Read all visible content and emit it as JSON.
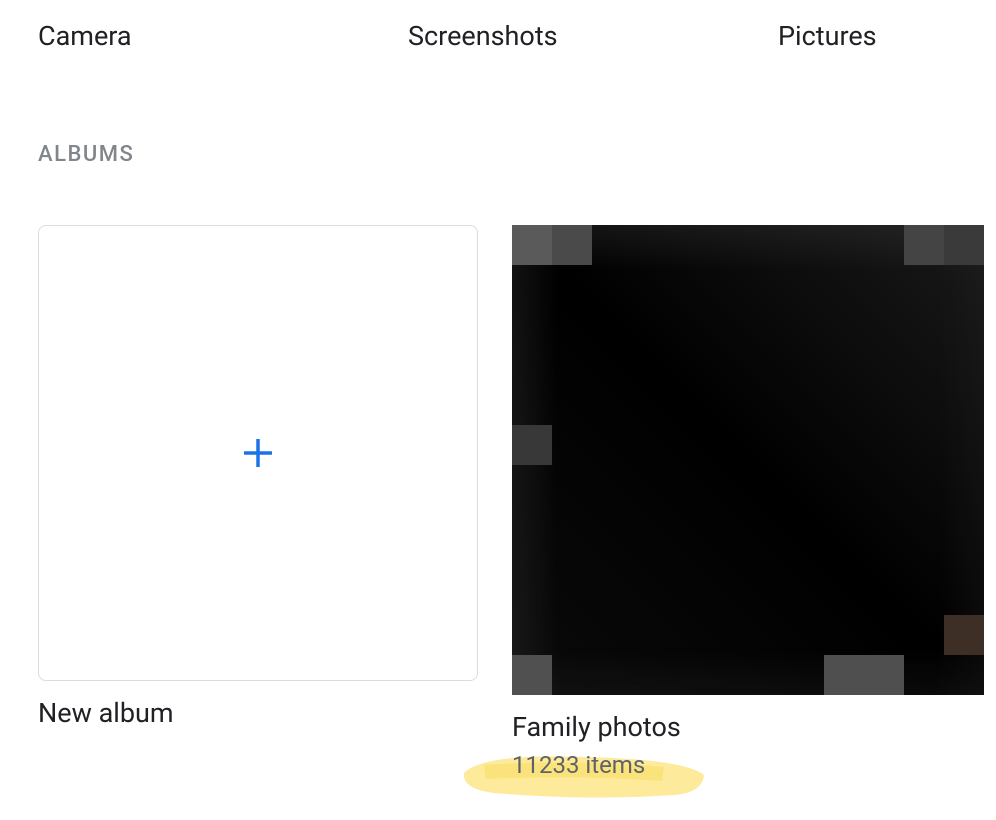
{
  "folders": {
    "camera_label": "Camera",
    "screenshots_label": "Screenshots",
    "pictures_label": "Pictures"
  },
  "section_header": "ALBUMS",
  "albums": {
    "new_album_label": "New album",
    "family": {
      "title": "Family photos",
      "item_count_label": "11233 items"
    }
  }
}
